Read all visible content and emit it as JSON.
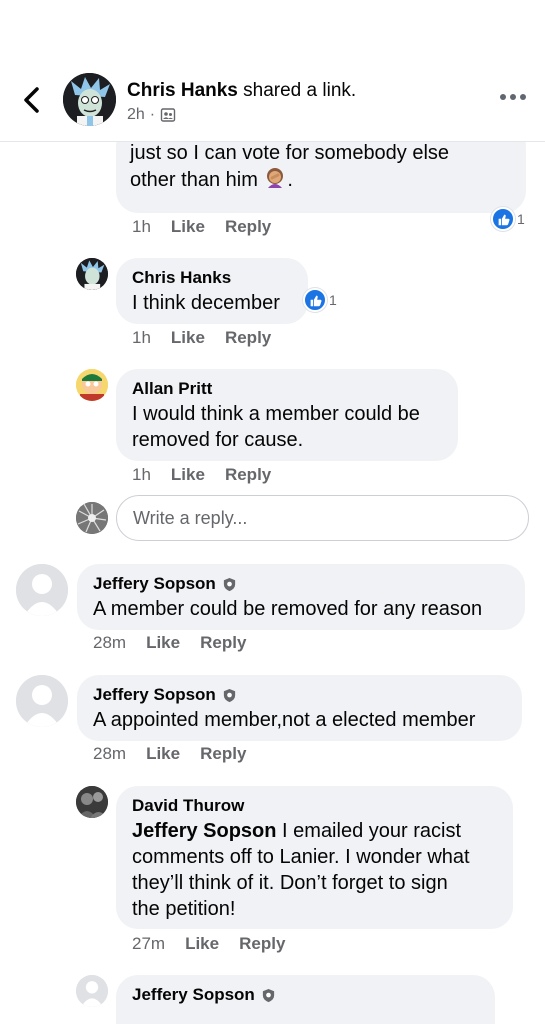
{
  "header": {
    "author": "Chris Hanks",
    "action": " shared a link.",
    "time": "2h",
    "separator": "·",
    "icons": {
      "back": "chevron-left-icon",
      "privacy": "group-privacy-icon",
      "more": "more-horizontal-icon"
    }
  },
  "comments": [
    {
      "text_line1": "just so I can vote for somebody else",
      "text_line2": "other than him",
      "emoji": "woman-facepalming-emoji",
      "trailing": ".",
      "time": "1h",
      "like": "Like",
      "reply": "Reply",
      "reactions": "1"
    },
    {
      "author": "Chris Hanks",
      "text": "I think december",
      "time": "1h",
      "like": "Like",
      "reply": "Reply",
      "reactions": "1"
    },
    {
      "author": "Allan Pritt",
      "text_line1": "I would think a member could be",
      "text_line2": "removed for cause.",
      "time": "1h",
      "like": "Like",
      "reply": "Reply"
    },
    {
      "author": "Jeffery Sopson",
      "text": "A member could be removed for any reason",
      "time": "28m",
      "like": "Like",
      "reply": "Reply"
    },
    {
      "author": "Jeffery Sopson",
      "text": "A appointed member,not a elected member",
      "time": "28m",
      "like": "Like",
      "reply": "Reply"
    },
    {
      "author": "David Thurow",
      "mention": "Jeffery Sopson",
      "text_line1": " I emailed your racist",
      "text_line2": "comments off to Lanier. I wonder what",
      "text_line3": "they’ll think of it. Don’t forget to sign",
      "text_line4": "the petition!",
      "time": "27m",
      "like": "Like",
      "reply": "Reply"
    },
    {
      "author": "Jeffery Sopson"
    }
  ],
  "reply_box": {
    "placeholder": "Write a reply..."
  },
  "colors": {
    "bubble": "#f0f2f5",
    "like_blue": "#1b74e4",
    "meta_gray": "#65676b"
  }
}
